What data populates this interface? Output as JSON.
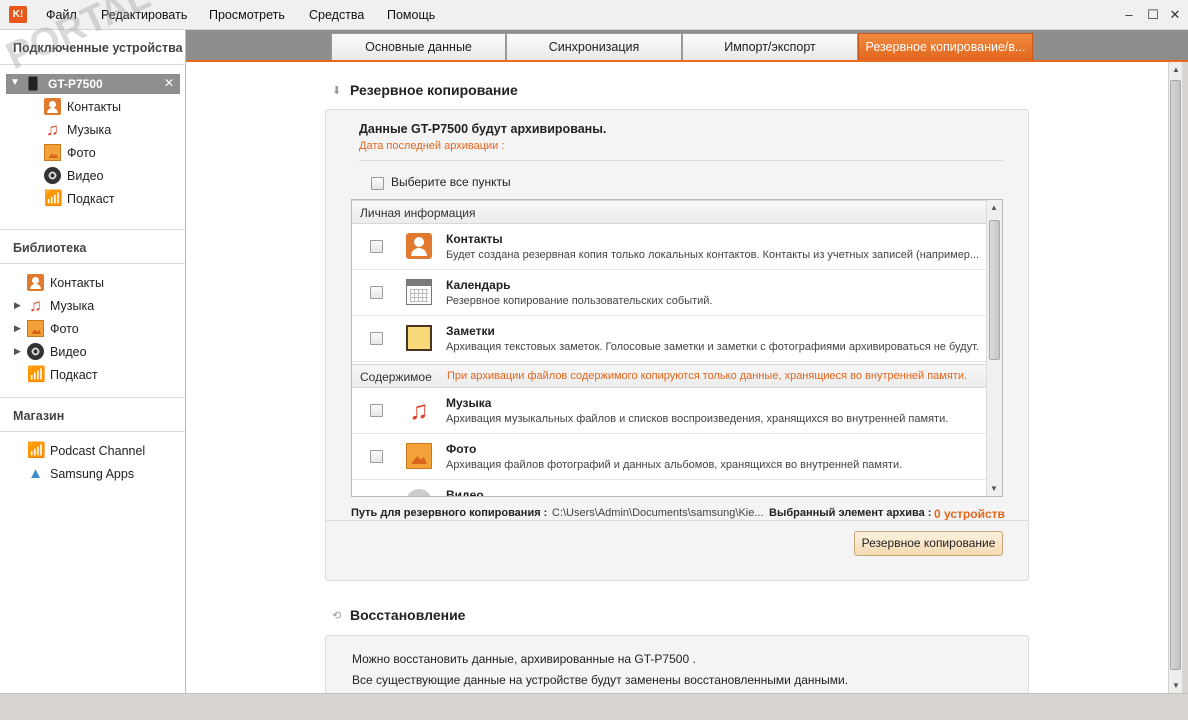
{
  "menubar": {
    "logo": "K!",
    "items": [
      "Файл",
      "Редактировать",
      "Просмотреть",
      "Средства",
      "Помощь"
    ],
    "window_buttons": [
      "–",
      "☐",
      "✕"
    ]
  },
  "sidebar": {
    "connected_header": "Подключенные устройства",
    "device": {
      "name": "GT-P7500",
      "close": "✕"
    },
    "device_items": [
      "Контакты",
      "Музыка",
      "Фото",
      "Видео",
      "Подкаст"
    ],
    "library_header": "Библиотека",
    "library_items": [
      "Контакты",
      "Музыка",
      "Фото",
      "Видео",
      "Подкаст"
    ],
    "store_header": "Магазин",
    "store_items": [
      "Podcast Channel",
      "Samsung Apps"
    ]
  },
  "tabs": [
    {
      "label": "Основные данные",
      "active": false
    },
    {
      "label": "Синхронизация",
      "active": false
    },
    {
      "label": "Импорт/экспорт",
      "active": false
    },
    {
      "label": "Резервное копирование/в...",
      "active": true
    }
  ],
  "backup": {
    "title": "Резервное копирование",
    "panel_title": "Данные GT-P7500  будут архивированы.",
    "last_backup": "Дата последней архивации :",
    "select_all": "Выберите все пункты",
    "personal_group": "Личная информация",
    "personal_items": [
      {
        "title": "Контакты",
        "desc": "Будет создана резервная копия только локальных контактов. Контакты из учетных записей (например..."
      },
      {
        "title": "Календарь",
        "desc": "Резервное копирование пользовательских событий."
      },
      {
        "title": "Заметки",
        "desc": "Архивация текстовых заметок. Голосовые заметки и заметки с фотографиями архивироваться не будут."
      }
    ],
    "content_group": "Содержимое",
    "content_note": "При архивации файлов содержимого копируются только данные, хранящиеся во внутренней памяти.",
    "content_items": [
      {
        "title": "Музыка",
        "desc": "Архивация музыкальных файлов и списков воспроизведения, хранящихся во внутренней памяти."
      },
      {
        "title": "Фото",
        "desc": "Архивация файлов фотографий и данных альбомов, хранящихся во внутренней памяти."
      },
      {
        "title": "Видео",
        "desc": ""
      }
    ],
    "path_label": "Путь для резервного копирования :",
    "path_value": "C:\\Users\\Admin\\Documents\\samsung\\Kie...",
    "selected_label": "Выбранный элемент архива :",
    "selected_value": "0 устройств",
    "button": "Резервное копирование"
  },
  "restore": {
    "title": "Восстановление",
    "line1": "Можно восстановить данные, архивированные на GT-P7500 .",
    "line2": "Все существующие данные на устройстве будут заменены восстановленными данными."
  },
  "watermark": "PORTAL",
  "colors": {
    "accent": "#e2661d",
    "tab_active": "#e86b1f",
    "sidebar_device": "#8f8f8f"
  }
}
